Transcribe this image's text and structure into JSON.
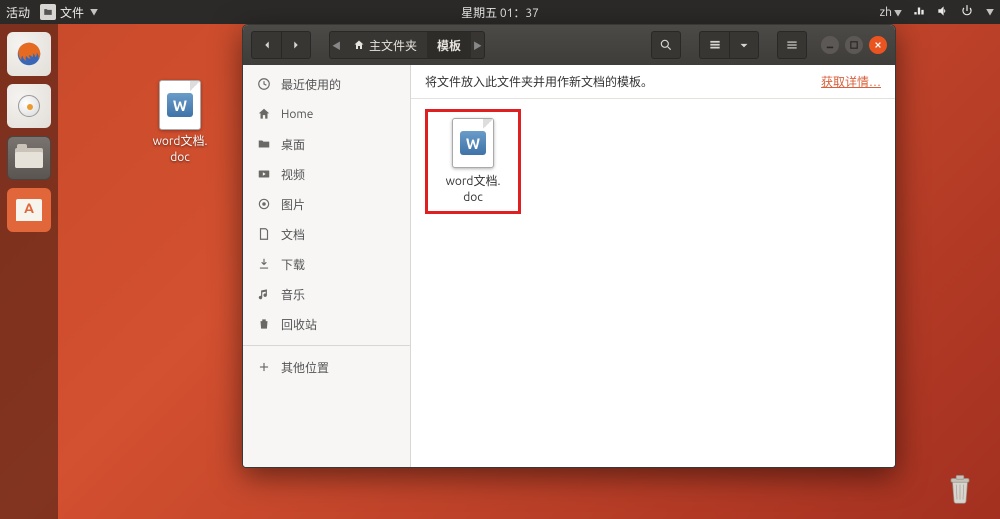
{
  "topbar": {
    "activities": "活动",
    "app_menu_label": "文件",
    "clock": "星期五 01：37",
    "input_method": "zh"
  },
  "desktop": {
    "icon_label": "word文档.\ndoc"
  },
  "window": {
    "path": {
      "home_label": "主文件夹",
      "current_label": "模板"
    },
    "sidebar": {
      "items": [
        {
          "label": "最近使用的"
        },
        {
          "label": "Home"
        },
        {
          "label": "桌面"
        },
        {
          "label": "视频"
        },
        {
          "label": "图片"
        },
        {
          "label": "文档"
        },
        {
          "label": "下载"
        },
        {
          "label": "音乐"
        },
        {
          "label": "回收站"
        }
      ],
      "other_locations": "其他位置"
    },
    "info_bar": {
      "message": "将文件放入此文件夹并用作新文档的模板。",
      "link": "获取详情…"
    },
    "files": [
      {
        "label": "word文档.\ndoc"
      }
    ]
  }
}
